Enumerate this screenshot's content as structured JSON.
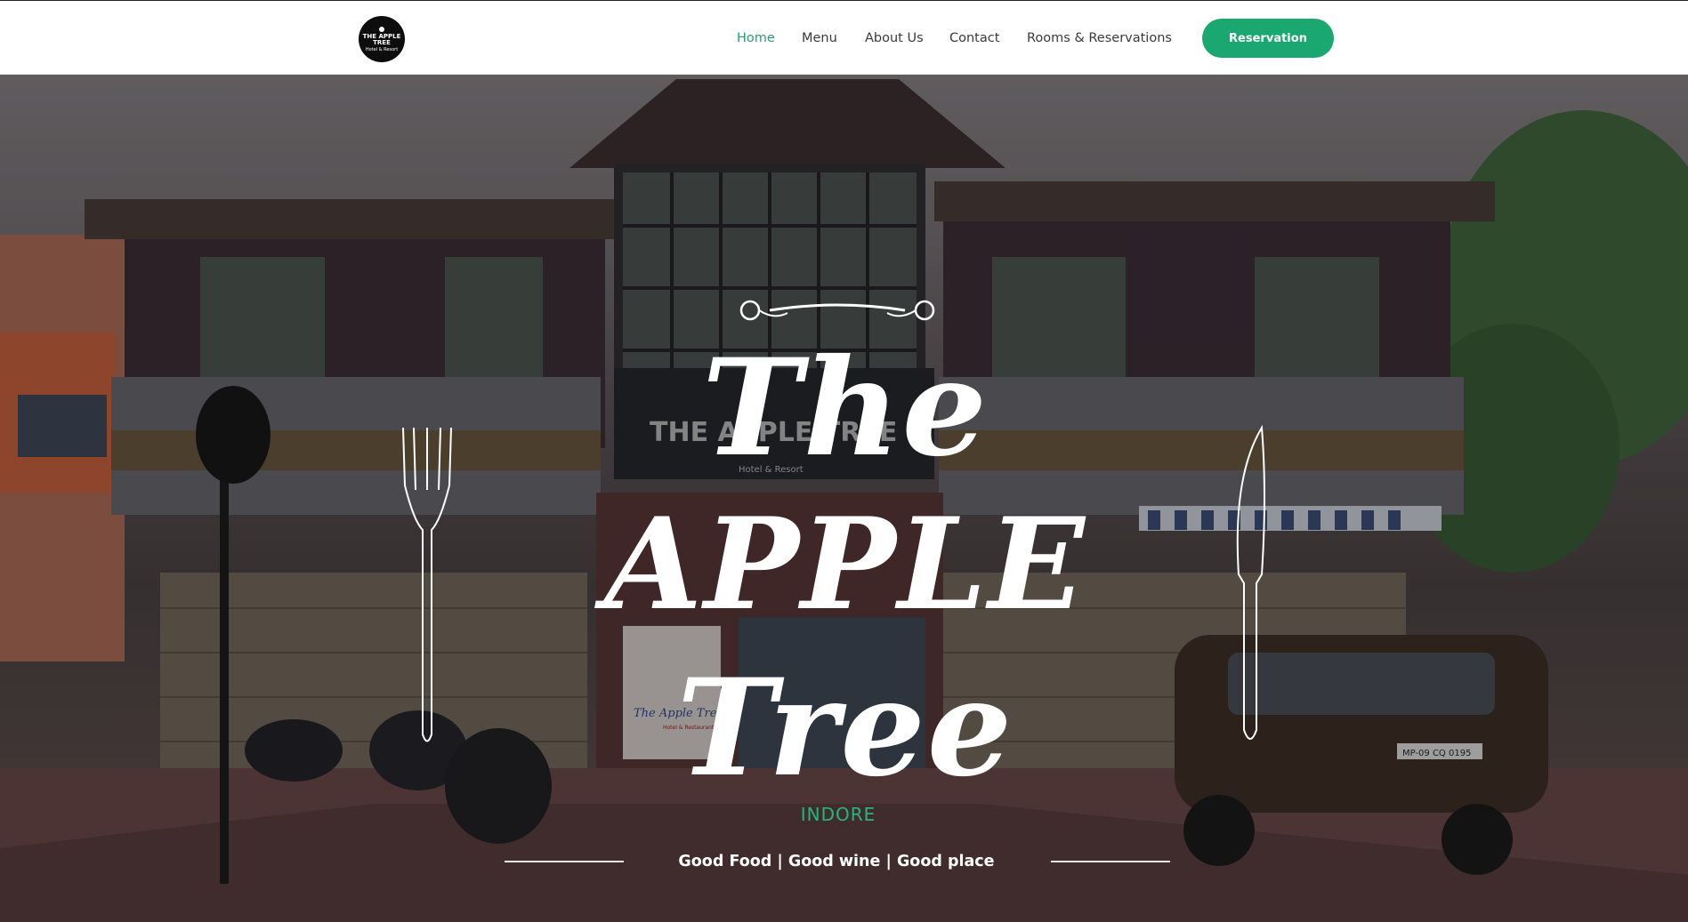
{
  "header": {
    "logo": {
      "line1": "THE APPLE TREE",
      "line2": "Hotel & Resort"
    },
    "nav": [
      {
        "label": "Home",
        "active": true
      },
      {
        "label": "Menu",
        "active": false
      },
      {
        "label": "About Us",
        "active": false
      },
      {
        "label": "Contact",
        "active": false
      },
      {
        "label": "Rooms & Reservations",
        "active": false
      }
    ],
    "cta_label": "Reservation"
  },
  "hero": {
    "title_line1": "The",
    "title_line2": "APPLE",
    "title_line3": "Tree",
    "city": "INDORE",
    "tagline": "Good Food | Good wine | Good place",
    "building_sign": {
      "name": "THE APPLE TREE",
      "sub": "Hotel & Resort"
    },
    "door_sign": {
      "name": "The Apple Tree",
      "sub": "Hotel & Restaurant"
    },
    "plate": "MP-09 CQ 0195"
  },
  "colors": {
    "accent": "#1aa870",
    "nav_active": "#2a9d6c",
    "city": "#27b57a"
  }
}
